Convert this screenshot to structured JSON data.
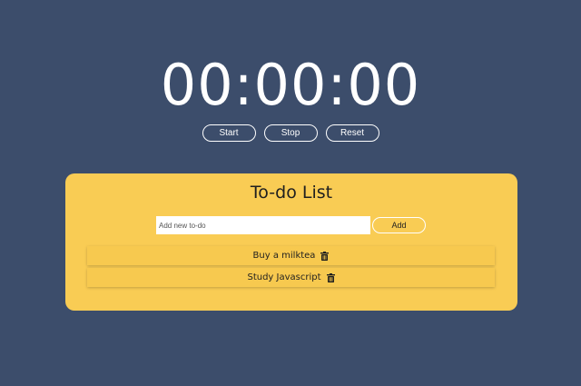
{
  "timer": {
    "display": "00:00:00",
    "buttons": {
      "start": "Start",
      "stop": "Stop",
      "reset": "Reset"
    }
  },
  "todo": {
    "title": "To-do List",
    "input": {
      "value": "",
      "placeholder": "Add new to-do"
    },
    "add_label": "Add",
    "items": [
      {
        "label": "Buy a milktea",
        "icon": "trash-icon"
      },
      {
        "label": "Study Javascript",
        "icon": "trash-icon"
      }
    ]
  },
  "colors": {
    "background": "#3c4d6b",
    "card": "#f9cc54",
    "text_light": "#ffffff",
    "text_dark": "#1f1f1f"
  }
}
